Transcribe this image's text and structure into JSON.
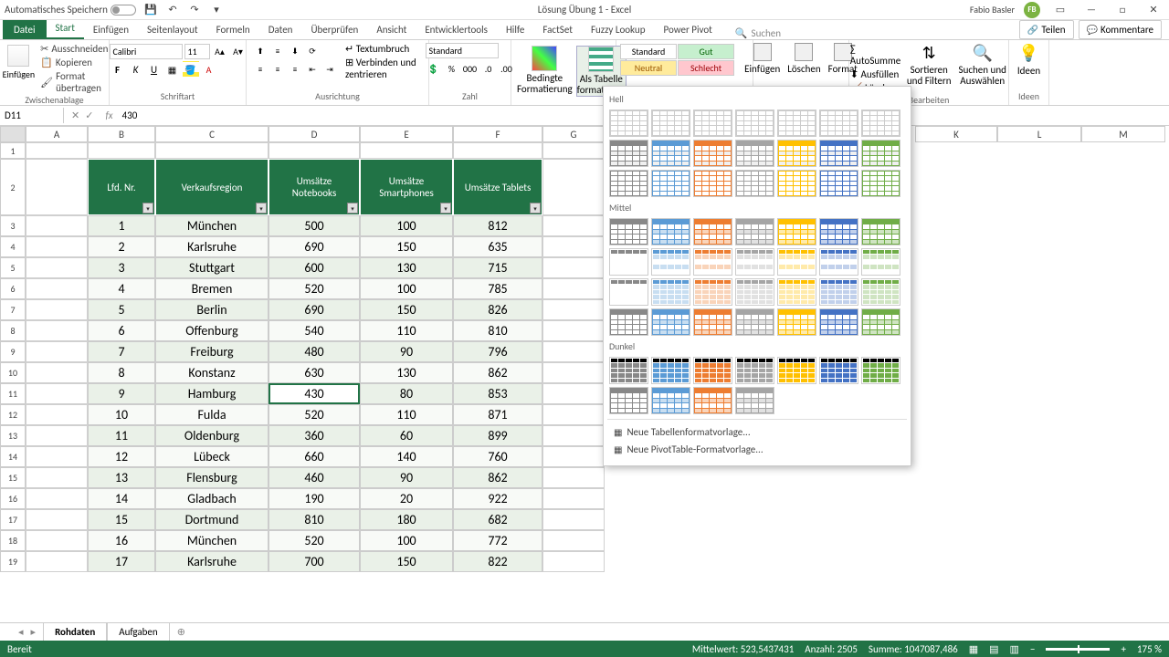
{
  "title": "Lösung Übung 1  -  Excel",
  "user": {
    "name": "Fabio Basler",
    "initials": "FB"
  },
  "qat": {
    "autosave": "Automatisches Speichern"
  },
  "tabs": {
    "file": "Datei",
    "start": "Start",
    "einf": "Einfügen",
    "layout": "Seitenlayout",
    "formeln": "Formeln",
    "daten": "Daten",
    "ueber": "Überprüfen",
    "ansicht": "Ansicht",
    "entw": "Entwicklertools",
    "hilfe": "Hilfe",
    "factset": "FactSet",
    "fuzzy": "Fuzzy Lookup",
    "pivot": "Power Pivot",
    "suchen": "Suchen",
    "teilen": "Teilen",
    "komm": "Kommentare"
  },
  "ribbon": {
    "paste": "Einfügen",
    "cut": "Ausschneiden",
    "copy": "Kopieren",
    "format_paint": "Format übertragen",
    "g_clip": "Zwischenablage",
    "g_font": "Schriftart",
    "g_align": "Ausrichtung",
    "g_num": "Zahl",
    "g_edit": "Bearbeiten",
    "g_ideen": "Ideen",
    "font_name": "Calibri",
    "font_size": "11",
    "wrap": "Textumbruch",
    "merge": "Verbinden und zentrieren",
    "num_fmt": "Standard",
    "cond": "Bedingte Formatierung",
    "astable": "Als Tabelle formatieren",
    "s_std": "Standard",
    "s_gut": "Gut",
    "s_neutral": "Neutral",
    "s_schlecht": "Schlecht",
    "insert": "Einfügen",
    "delete": "Löschen",
    "format": "Format",
    "autosum": "AutoSumme",
    "fill": "Ausfüllen",
    "clear": "Löschen",
    "sort": "Sortieren und Filtern",
    "find": "Suchen und Auswählen",
    "ideen": "Ideen"
  },
  "namebox": "D11",
  "formula": "430",
  "gallery": {
    "hell": "Hell",
    "mittel": "Mittel",
    "dunkel": "Dunkel",
    "new1": "Neue Tabellenformatvorlage...",
    "new2": "Neue PivotTable-Formatvorlage..."
  },
  "cols": [
    "A",
    "B",
    "C",
    "D",
    "E",
    "F",
    "G",
    "K",
    "L",
    "M"
  ],
  "headers": [
    "Lfd. Nr.",
    "Verkaufsregion",
    "Umsätze Notebooks",
    "Umsätze Smartphones",
    "Umsätze Tablets"
  ],
  "rows": [
    [
      1,
      "München",
      500,
      100,
      812
    ],
    [
      2,
      "Karlsruhe",
      690,
      150,
      635
    ],
    [
      3,
      "Stuttgart",
      600,
      130,
      715
    ],
    [
      4,
      "Bremen",
      520,
      100,
      785
    ],
    [
      5,
      "Berlin",
      690,
      150,
      826
    ],
    [
      6,
      "Offenburg",
      540,
      110,
      810
    ],
    [
      7,
      "Freiburg",
      480,
      90,
      796
    ],
    [
      8,
      "Konstanz",
      630,
      130,
      862
    ],
    [
      9,
      "Hamburg",
      430,
      80,
      853
    ],
    [
      10,
      "Fulda",
      520,
      110,
      871
    ],
    [
      11,
      "Oldenburg",
      360,
      60,
      899
    ],
    [
      12,
      "Lübeck",
      660,
      140,
      760
    ],
    [
      13,
      "Flensburg",
      460,
      90,
      862
    ],
    [
      14,
      "Gladbach",
      190,
      20,
      922
    ],
    [
      15,
      "Dortmund",
      810,
      180,
      682
    ],
    [
      16,
      "München",
      520,
      100,
      772
    ],
    [
      17,
      "Karlsruhe",
      700,
      150,
      822
    ]
  ],
  "sheets": {
    "s1": "Rohdaten",
    "s2": "Aufgaben"
  },
  "status": {
    "ready": "Bereit",
    "mean": "Mittelwert: 523,5437431",
    "count": "Anzahl: 2505",
    "sum": "Summe: 1047087,486",
    "zoom": "175 %"
  }
}
